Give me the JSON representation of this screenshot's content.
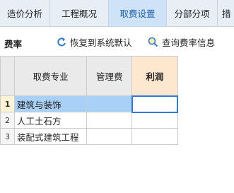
{
  "tabs": [
    {
      "label": "造价分析",
      "active": false
    },
    {
      "label": "工程概况",
      "active": false
    },
    {
      "label": "取费设置",
      "active": true
    },
    {
      "label": "分部分项",
      "active": false
    },
    {
      "label": "措",
      "active": false
    }
  ],
  "toolbar": {
    "title": "费率",
    "restore_label": "恢复到系统默认",
    "query_label": "查询费率信息"
  },
  "table": {
    "headers": {
      "name": "取费专业",
      "mgmt": "管理费",
      "profit": "利润"
    },
    "rows": [
      {
        "num": "1",
        "name": "建筑与装饰",
        "mgmt": "",
        "profit": ""
      },
      {
        "num": "2",
        "name": "人工土石方",
        "mgmt": "",
        "profit": ""
      },
      {
        "num": "3",
        "name": "装配式建筑工程",
        "mgmt": "",
        "profit": ""
      }
    ]
  },
  "colors": {
    "accent": "#2f7ad6",
    "selected_row": "#a9d1f7",
    "profit_header": "#fde7cf"
  }
}
